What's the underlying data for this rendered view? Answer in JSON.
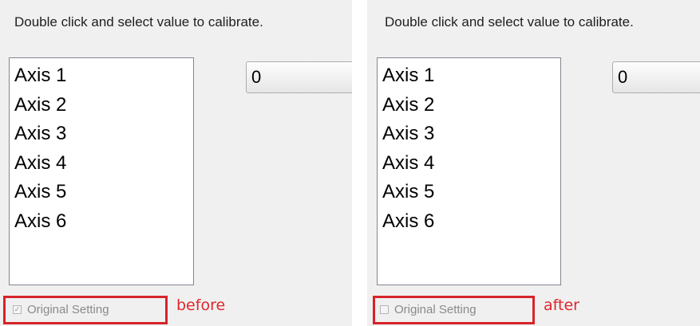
{
  "before": {
    "instruction": "Double click and select value to calibrate.",
    "axes": [
      "Axis 1",
      "Axis 2",
      "Axis 3",
      "Axis 4",
      "Axis 5",
      "Axis 6"
    ],
    "value": "0",
    "checkbox_label": "Original Setting",
    "checkbox_checked": true,
    "annotation": "before"
  },
  "after": {
    "instruction": "Double click and select value to calibrate.",
    "axes": [
      "Axis 1",
      "Axis 2",
      "Axis 3",
      "Axis 4",
      "Axis 5",
      "Axis 6"
    ],
    "value": "0",
    "checkbox_label": "Original Setting",
    "checkbox_checked": false,
    "annotation": "after"
  },
  "colors": {
    "annotation_red": "#d8232a",
    "dialog_background": "#f0f0f0"
  }
}
